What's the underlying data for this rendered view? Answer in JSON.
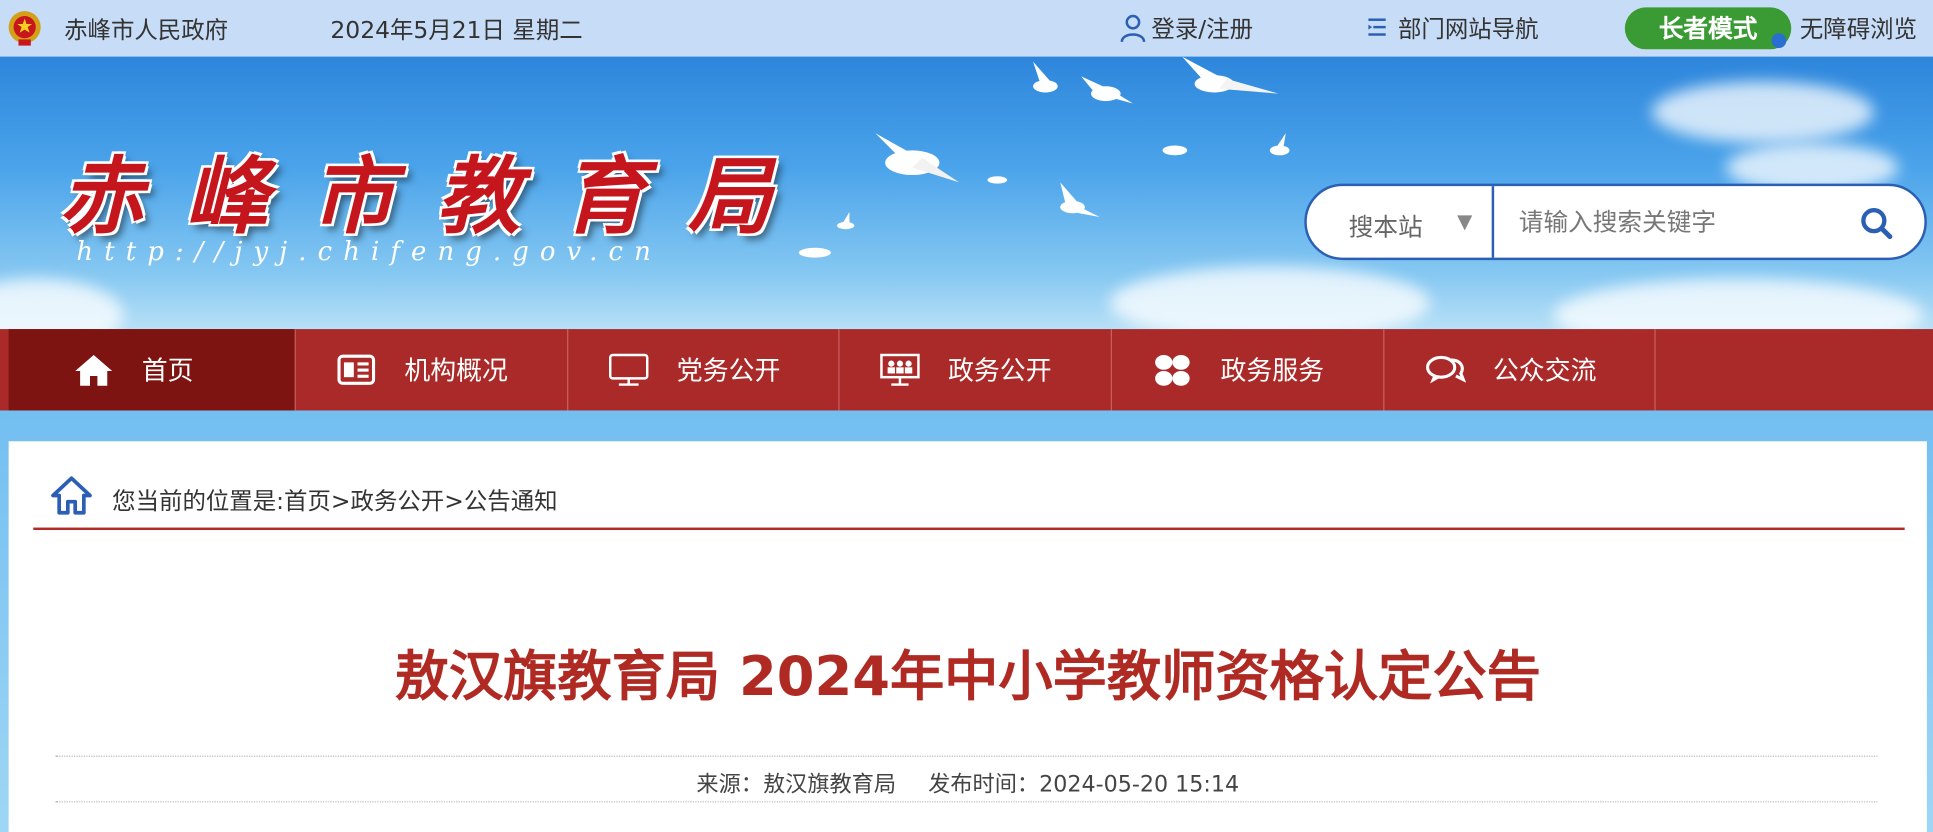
{
  "topbar": {
    "gov_name": "赤峰市人民政府",
    "date": "2024年5月21日 星期二",
    "login": "登录/注册",
    "dept_nav": "部门网站导航",
    "elder_mode": "长者模式",
    "accessible": "无障碍浏览"
  },
  "banner": {
    "title": "赤峰市教育局",
    "url": "http://jyj.chifeng.gov.cn"
  },
  "search": {
    "scope": "搜本站",
    "scope_arrow": "▼",
    "placeholder": "请输入搜索关键字"
  },
  "nav": {
    "items": [
      {
        "label": "首页",
        "icon": "home-icon"
      },
      {
        "label": "机构概况",
        "icon": "news-icon"
      },
      {
        "label": "党务公开",
        "icon": "monitor-icon"
      },
      {
        "label": "政务公开",
        "icon": "people-board-icon"
      },
      {
        "label": "政务服务",
        "icon": "grid-icon"
      },
      {
        "label": "公众交流",
        "icon": "chat-icon"
      }
    ]
  },
  "breadcrumb": {
    "prefix": "您当前的位置是:",
    "items": [
      "首页",
      "政务公开",
      "公告通知"
    ],
    "separator": ">"
  },
  "article": {
    "title": "敖汉旗教育局 2024年中小学教师资格认定公告",
    "source_label": "来源：",
    "source": "敖汉旗教育局",
    "time_label": "发布时间：",
    "time": "2024-05-20 15:14"
  },
  "colors": {
    "nav_bg": "#a92a28",
    "nav_active": "#7d1412",
    "title_red": "#b02a24",
    "elder_green": "#3a9a33",
    "search_border": "#2b5fb3"
  }
}
